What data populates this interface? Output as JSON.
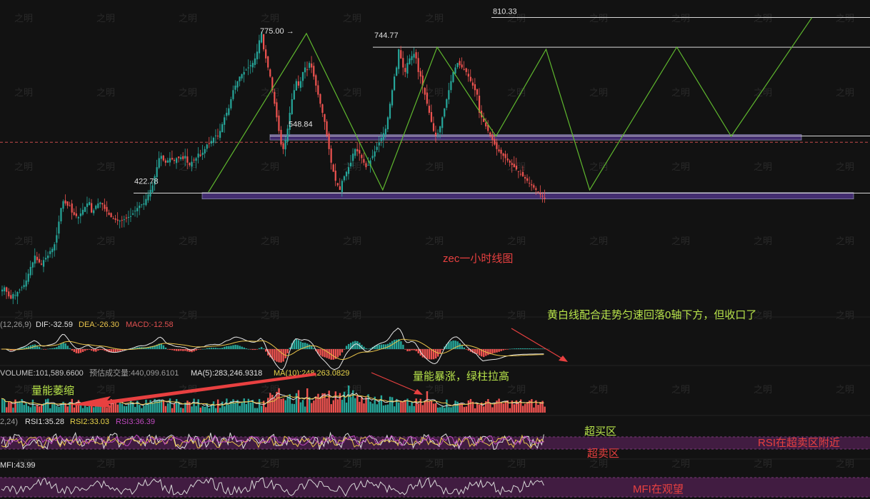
{
  "watermark": "之明",
  "chart_data": [
    {
      "type": "candlestick",
      "panel": "price",
      "title": "zec一小时线图",
      "bar_count": 250,
      "price_levels": [
        {
          "label": "810.33",
          "value": 810.33
        },
        {
          "label": "775.00 →",
          "value": 775.0
        },
        {
          "label": "744.77",
          "value": 744.77
        },
        {
          "label": "548.84",
          "value": 548.84
        },
        {
          "label": "422.78",
          "value": 422.78
        }
      ],
      "current_price_line": 535,
      "zones": [
        {
          "from": 540,
          "to": 552,
          "color": "#5a3a9a"
        },
        {
          "from": 410,
          "to": 424,
          "color": "#5a3a9a"
        }
      ],
      "path_projection": [
        {
          "bar": 95,
          "price": 425
        },
        {
          "bar": 140,
          "price": 775
        },
        {
          "bar": 175,
          "price": 430
        },
        {
          "bar": 200,
          "price": 745
        },
        {
          "bar": 227,
          "price": 548
        },
        {
          "bar": 250,
          "price": 740
        },
        {
          "bar": 270,
          "price": 430
        },
        {
          "bar": 310,
          "price": 745
        },
        {
          "bar": 335,
          "price": 548
        },
        {
          "bar": 372,
          "price": 810
        }
      ],
      "close_series": [
        210,
        215,
        205,
        195,
        190,
        200,
        198,
        205,
        210,
        215,
        220,
        230,
        245,
        260,
        270,
        285,
        275,
        270,
        265,
        275,
        280,
        285,
        295,
        300,
        310,
        330,
        360,
        390,
        405,
        400,
        395,
        395,
        380,
        375,
        372,
        370,
        378,
        386,
        392,
        400,
        403,
        380,
        385,
        395,
        400,
        402,
        398,
        388,
        382,
        375,
        370,
        366,
        364,
        362,
        362,
        363,
        365,
        367,
        370,
        372,
        378,
        384,
        390,
        395,
        398,
        400,
        410,
        420,
        430,
        440,
        460,
        480,
        500,
        505,
        495,
        490,
        495,
        500,
        497,
        494,
        500,
        500,
        502,
        498,
        505,
        490,
        485,
        492,
        496,
        500,
        510,
        505,
        512,
        520,
        530,
        532,
        538,
        545,
        550,
        549,
        560,
        575,
        590,
        600,
        610,
        630,
        650,
        660,
        670,
        680,
        685,
        690,
        695,
        700,
        705,
        710,
        720,
        735,
        760,
        775,
        740,
        720,
        700,
        680,
        650,
        620,
        590,
        560,
        530,
        520,
        540,
        565,
        600,
        630,
        650,
        670,
        660,
        670,
        690,
        700,
        695,
        710,
        700,
        680,
        660,
        640,
        620,
        600,
        580,
        550,
        520,
        490,
        470,
        450,
        440,
        430,
        450,
        460,
        470,
        480,
        490,
        510,
        520,
        515,
        510,
        500,
        490,
        480,
        485,
        495,
        505,
        515,
        525,
        535,
        545,
        555,
        565,
        590,
        620,
        650,
        680,
        700,
        740,
        720,
        700,
        690,
        710,
        720,
        725,
        730,
        720,
        690,
        680,
        660,
        640,
        620,
        600,
        580,
        560,
        550,
        555,
        570,
        590,
        610,
        630,
        650,
        670,
        690,
        700,
        710,
        705,
        700,
        695,
        690,
        680,
        670,
        660,
        650,
        640,
        600,
        590,
        580,
        570,
        560,
        550,
        540,
        530,
        520,
        515,
        510,
        505,
        500,
        495,
        490,
        485,
        480,
        475,
        470,
        465,
        460,
        455,
        450,
        445,
        440,
        435,
        430,
        425,
        420,
        415,
        410
      ]
    },
    {
      "type": "macd",
      "panel": "macd",
      "params": "(12,26,9)",
      "DIF_label": "DIF:-32.59",
      "DEA_label": "DEA:-26.30",
      "MACD_label": "MACD:-12.58",
      "DIF": -32.59,
      "DEA": -26.3,
      "MACD": -12.58
    },
    {
      "type": "volume",
      "panel": "volume",
      "volume_label": "VOLUME:101,589.6600",
      "est_label": "预估成交量:440,099.6101",
      "ma5_label": "MA(5):283,246.9318",
      "ma10_label": "MA(10):248,263.0829",
      "volume": 101589.66,
      "estimated": 440099.6101,
      "ma5": 283246.9318,
      "ma10": 248263.0829
    },
    {
      "type": "rsi",
      "panel": "rsi",
      "params": "2,24)",
      "rsi1_label": "RSI1:35.28",
      "rsi2_label": "RSI2:33.03",
      "rsi3_label": "RSI3:36.39",
      "rsi1": 35.28,
      "rsi2": 33.03,
      "rsi3": 36.39
    },
    {
      "type": "mfi",
      "panel": "mfi",
      "mfi_label": "MFI:43.99",
      "mfi": 43.99
    }
  ],
  "annotations": {
    "macd_note": "黄白线配合走势匀速回落0轴下方，但收口了",
    "volume_shrink": "量能萎缩",
    "volume_surge": "量能暴涨，绿柱拉高",
    "overbought": "超买区",
    "oversold": "超卖区",
    "rsi_note": "RSI在超卖区附近",
    "mfi_note": "MFI在观望"
  },
  "colors": {
    "up": "#26a69a",
    "down": "#ef5350",
    "path": "#5fb82e",
    "level": "#d8d8d8",
    "dif": "#e8e8e8",
    "dea": "#e8c34a",
    "annotation_red": "#e84040",
    "annotation_green": "#b7e34a"
  }
}
